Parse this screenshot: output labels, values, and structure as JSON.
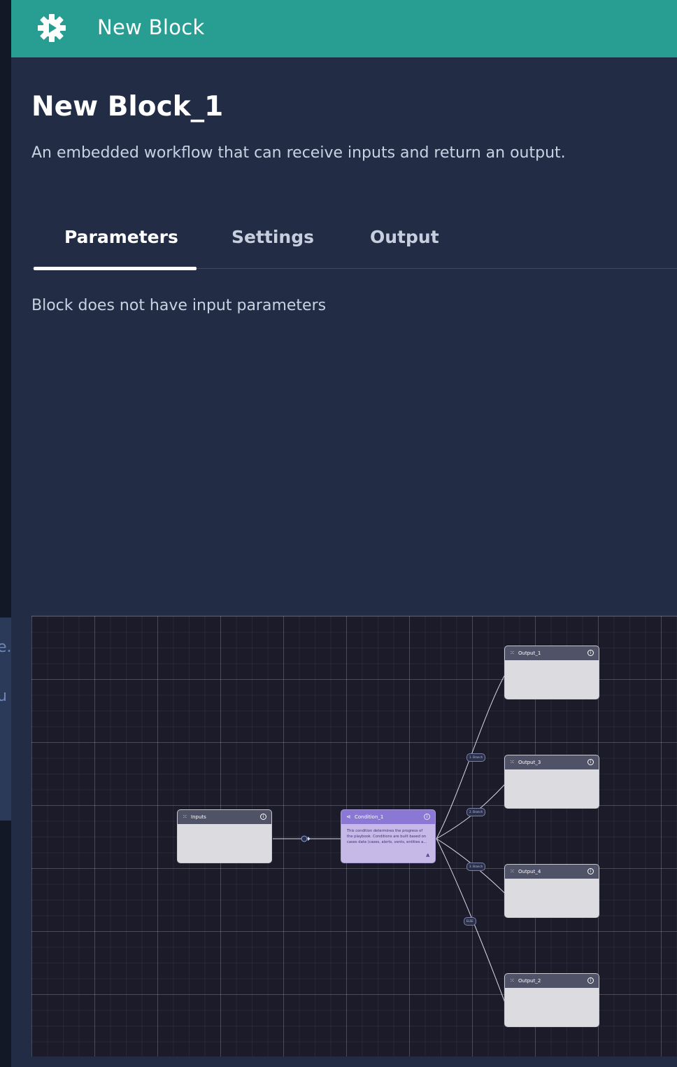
{
  "header": {
    "title": "New Block",
    "icon": "gear-icon"
  },
  "block": {
    "name": "New Block_1",
    "description": "An embedded workflow that can receive inputs and return an output."
  },
  "tabs": [
    {
      "label": "Parameters",
      "active": true
    },
    {
      "label": "Settings",
      "active": false
    },
    {
      "label": "Output",
      "active": false
    }
  ],
  "parameters": {
    "empty_message": "Block does not have input parameters"
  },
  "workflow": {
    "nodes": {
      "inputs": {
        "label": "Inputs"
      },
      "condition": {
        "label": "Condition_1",
        "description": "This condition determines the progress of the playbook. Conditions are built based on cases data (cases, alerts, vents, entities a...",
        "marker": "A"
      },
      "output_1": {
        "label": "Output_1"
      },
      "output_3": {
        "label": "Output_3"
      },
      "output_4": {
        "label": "Output_4"
      },
      "output_2": {
        "label": "Output_2"
      }
    },
    "branches": [
      "1. Branch",
      "2. Branch",
      "3. Branch",
      "ELSE"
    ]
  },
  "colors": {
    "header": "#289e92",
    "panel": "#222d45",
    "canvas": "#1b1b2a",
    "node": "#dcdce0",
    "condition_node": "#c6b9e8"
  }
}
